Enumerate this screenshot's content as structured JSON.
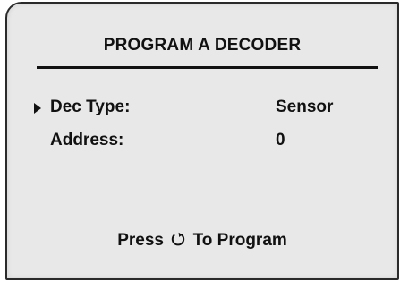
{
  "screen": {
    "title": "PROGRAM A DECODER",
    "fields": [
      {
        "label": "Dec Type:",
        "value": "Sensor",
        "selected": true
      },
      {
        "label": "Address:",
        "value": "0",
        "selected": false
      }
    ],
    "footer": {
      "before": "Press",
      "icon": "rotate-dial-icon",
      "after": "To Program"
    }
  }
}
